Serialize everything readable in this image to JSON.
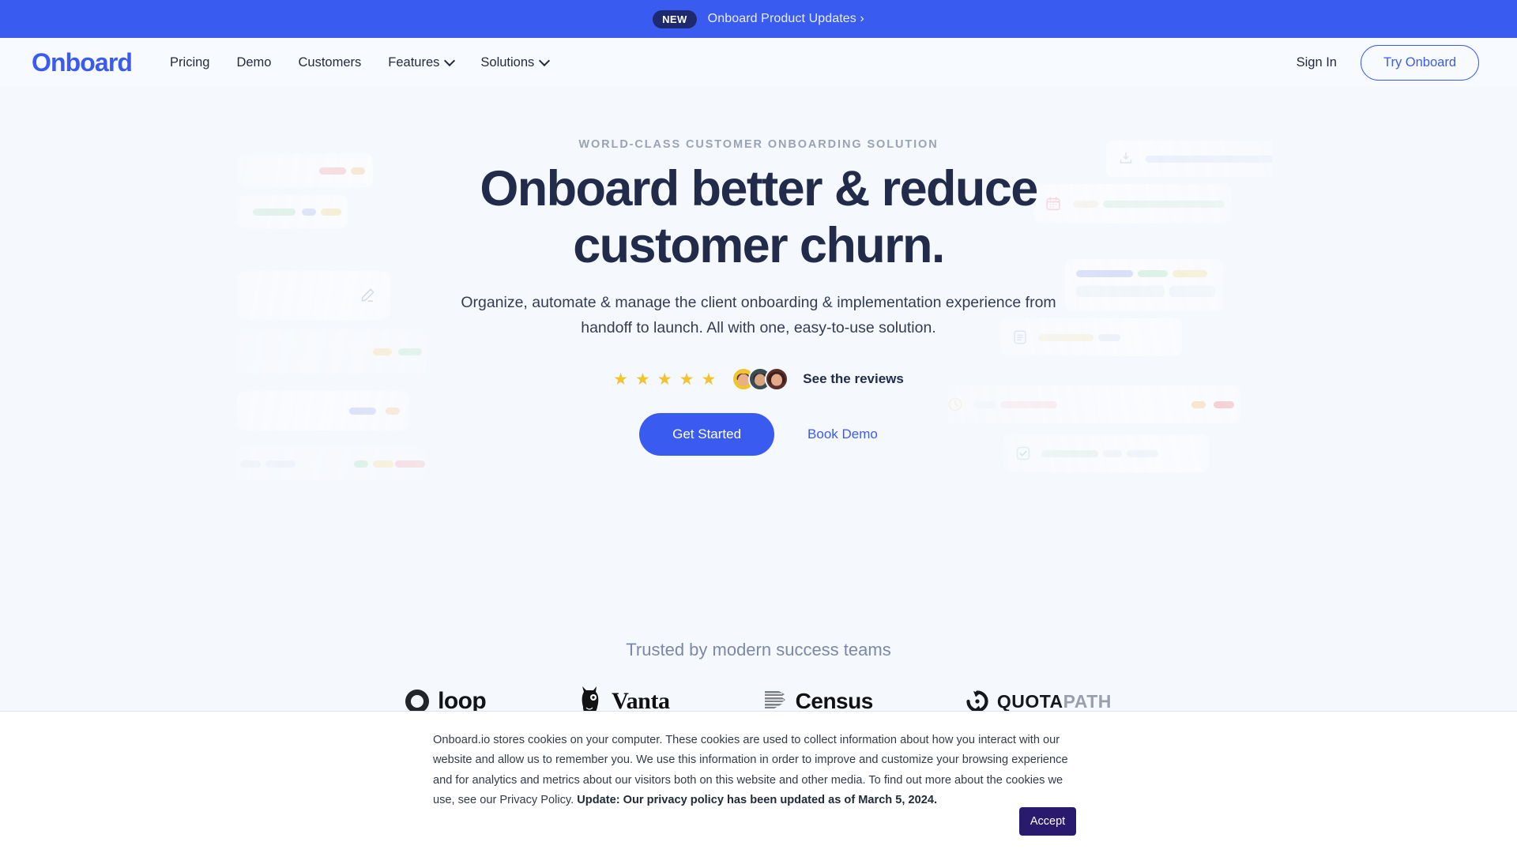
{
  "announcement": {
    "badge": "NEW",
    "text": "Onboard Product Updates  ›"
  },
  "header": {
    "logo": "Onboard",
    "nav": [
      {
        "label": "Pricing",
        "has_chevron": false
      },
      {
        "label": "Demo",
        "has_chevron": false
      },
      {
        "label": "Customers",
        "has_chevron": false
      },
      {
        "label": "Features",
        "has_chevron": true
      },
      {
        "label": "Solutions",
        "has_chevron": true
      }
    ],
    "sign_in": "Sign In",
    "try_button": "Try Onboard"
  },
  "hero": {
    "eyebrow": "WORLD-CLASS CUSTOMER ONBOARDING SOLUTION",
    "headline_line1": "Onboard better & reduce",
    "headline_line2": "customer churn.",
    "subhead_line1": "Organize, automate & manage the client onboarding & implementation experience from",
    "subhead_line2": "handoff to launch. All with one, easy-to-use solution.",
    "star_count": 5,
    "star_glyph": "★",
    "reviews_link": "See the reviews",
    "primary_cta": "Get Started",
    "secondary_cta": "Book Demo"
  },
  "trusted": {
    "title": "Trusted by modern success teams",
    "logos": [
      {
        "name": "loop",
        "icon": "ring-icon"
      },
      {
        "name": "Vanta",
        "icon": "llama-icon"
      },
      {
        "name": "Census",
        "icon": "hex-stripes-icon"
      },
      {
        "name_dark": "QUOTA",
        "name_light": "PATH",
        "icon": "circular-arrow-icon"
      }
    ]
  },
  "cookie": {
    "body": "Onboard.io stores cookies on your computer. These cookies are used to collect information about how you interact with our website and allow us to remember you. We use this information in order to improve and customize your browsing experience and for analytics and metrics about our visitors both on this website and other media. To find out more about the cookies we use, see our Privacy Policy. ",
    "bold": "Update: Our privacy policy has been updated as of March 5, 2024.",
    "accept": "Accept"
  },
  "colors": {
    "brand_blue": "#3a5bf0",
    "banner_blue": "#3a5bf0",
    "badge_navy": "#1f2a6e",
    "headline_navy": "#222b4a",
    "page_bg": "#f5f8fd",
    "star_gold": "#f2c230",
    "accept_purple": "#2a1a6e",
    "trusted_gray": "#7b88a8"
  }
}
